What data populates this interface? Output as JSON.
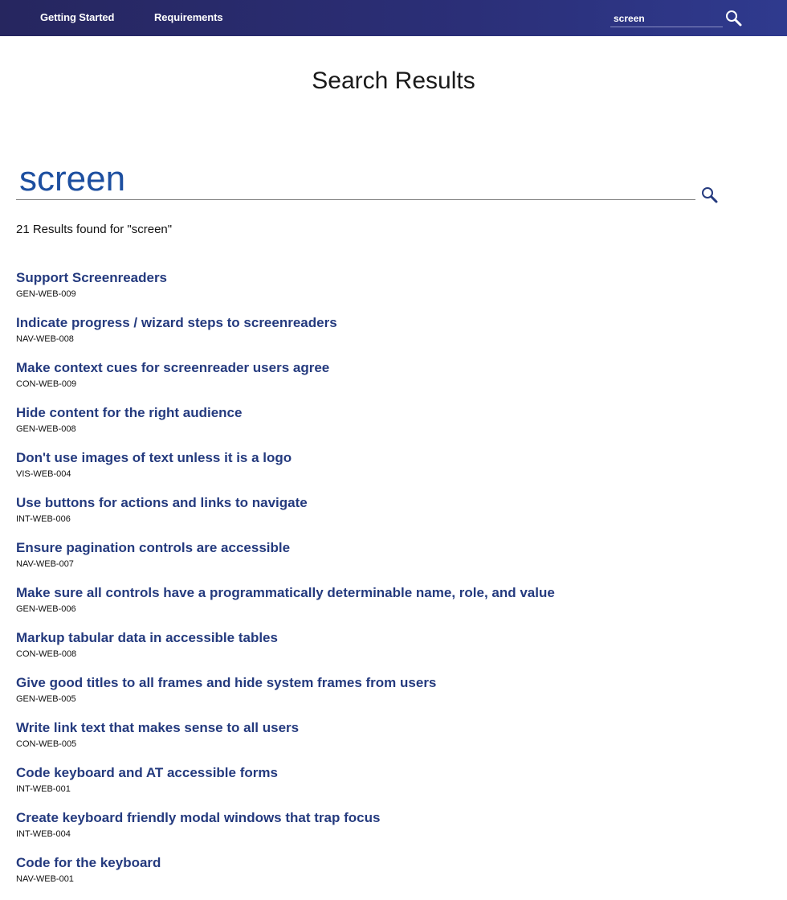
{
  "nav": {
    "links": [
      "Getting Started",
      "Requirements"
    ],
    "search_value": "screen"
  },
  "page": {
    "title": "Search Results",
    "search_value": "screen",
    "results_count": "21 Results found for \"screen\""
  },
  "results": [
    {
      "title": "Support Screenreaders",
      "id": "GEN-WEB-009"
    },
    {
      "title": "Indicate progress / wizard steps to screenreaders",
      "id": "NAV-WEB-008"
    },
    {
      "title": "Make context cues for screenreader users agree",
      "id": "CON-WEB-009"
    },
    {
      "title": "Hide content for the right audience",
      "id": "GEN-WEB-008"
    },
    {
      "title": "Don't use images of text unless it is a logo",
      "id": "VIS-WEB-004"
    },
    {
      "title": "Use buttons for actions and links to navigate",
      "id": "INT-WEB-006"
    },
    {
      "title": "Ensure pagination controls are accessible",
      "id": "NAV-WEB-007"
    },
    {
      "title": "Make sure all controls have a programmatically determinable name, role, and value",
      "id": "GEN-WEB-006"
    },
    {
      "title": "Markup tabular data in accessible tables",
      "id": "CON-WEB-008"
    },
    {
      "title": "Give good titles to all frames and hide system frames from users",
      "id": "GEN-WEB-005"
    },
    {
      "title": "Write link text that makes sense to all users",
      "id": "CON-WEB-005"
    },
    {
      "title": "Code keyboard and AT accessible forms",
      "id": "INT-WEB-001"
    },
    {
      "title": "Create keyboard friendly modal windows that trap focus",
      "id": "INT-WEB-004"
    },
    {
      "title": "Code for the keyboard",
      "id": "NAV-WEB-001"
    }
  ],
  "icons": {
    "top_search": "search-icon",
    "main_search": "search-icon"
  },
  "colors": {
    "nav_bg": "#2b2f78",
    "result_title": "#243a7e",
    "search_text": "#1d4fa0"
  }
}
